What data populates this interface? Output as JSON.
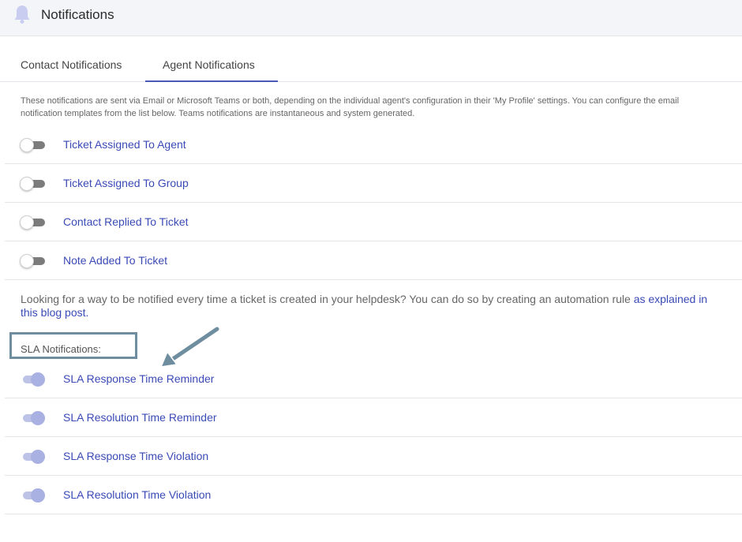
{
  "header": {
    "title": "Notifications",
    "icon": "bell-icon"
  },
  "tabs": [
    {
      "label": "Contact Notifications",
      "active": false
    },
    {
      "label": "Agent Notifications",
      "active": true
    }
  ],
  "description": "These notifications are sent via Email or Microsoft Teams or both, depending on the individual agent's configuration in their 'My Profile' settings. You can configure the email notification templates from the list below. Teams notifications are instantaneous and system generated.",
  "agent_notifications": [
    {
      "label": "Ticket Assigned To Agent",
      "enabled": false
    },
    {
      "label": "Ticket Assigned To Group",
      "enabled": false
    },
    {
      "label": "Contact Replied To Ticket",
      "enabled": false
    },
    {
      "label": "Note Added To Ticket",
      "enabled": false
    }
  ],
  "automation_info": {
    "text": "Looking for a way to be notified every time a ticket is created in your helpdesk? You can do so by creating an automation rule ",
    "link_text": "as explained in this blog post."
  },
  "sla": {
    "heading": "SLA Notifications:",
    "items": [
      {
        "label": "SLA Response Time Reminder",
        "enabled": true
      },
      {
        "label": "SLA Resolution Time Reminder",
        "enabled": true
      },
      {
        "label": "SLA Response Time Violation",
        "enabled": true
      },
      {
        "label": "SLA Resolution Time Violation",
        "enabled": true
      }
    ]
  },
  "colors": {
    "accent": "#3a4ab6",
    "tab_underline": "#4a59b5",
    "toggle_on": "#a9b1e2",
    "toggle_off_track": "#7c7c7c",
    "annotation": "#6e8ea0"
  }
}
